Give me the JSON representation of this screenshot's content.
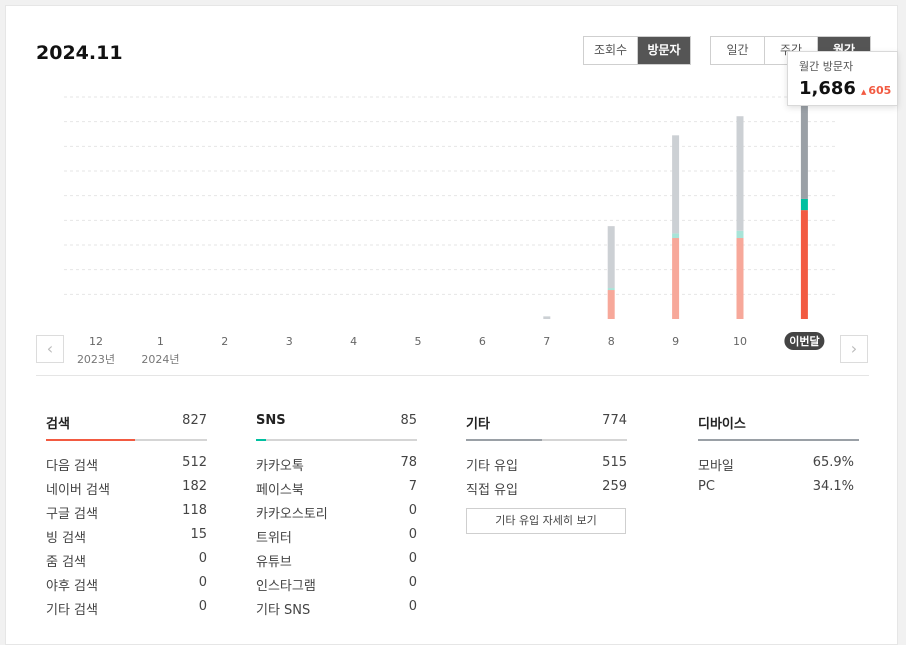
{
  "period_title": "2024.11",
  "metric_toggle": [
    {
      "label": "조회수",
      "active": false
    },
    {
      "label": "방문자",
      "active": true
    }
  ],
  "period_toggle": [
    {
      "label": "일간",
      "active": false
    },
    {
      "label": "주간",
      "active": false
    },
    {
      "label": "월간",
      "active": true
    }
  ],
  "tooltip": {
    "label": "월간 방문자",
    "value": "1,686",
    "delta": "605"
  },
  "colors": {
    "search": "#f25a41",
    "search_light": "#f7a89a",
    "sns": "#00c0a0",
    "sns_light": "#a8e4d8",
    "etc": "#9aa0a6",
    "etc_light": "#ccd0d4",
    "accent_current": "#444444"
  },
  "chart_data": {
    "type": "bar",
    "stacked": true,
    "categories": [
      "12",
      "1",
      "2",
      "3",
      "4",
      "5",
      "6",
      "7",
      "8",
      "9",
      "10",
      "이번달"
    ],
    "year_labels": [
      "2023년",
      "2024년",
      "",
      "",
      "",
      "",
      "",
      "",
      "",
      "",
      "",
      ""
    ],
    "series": [
      {
        "key": "search",
        "values": [
          0,
          0,
          0,
          0,
          0,
          0,
          0,
          0,
          220,
          615,
          615,
          827
        ]
      },
      {
        "key": "sns",
        "values": [
          0,
          0,
          0,
          0,
          0,
          0,
          0,
          0,
          10,
          35,
          55,
          85
        ]
      },
      {
        "key": "etc",
        "values": [
          0,
          0,
          0,
          0,
          0,
          0,
          0,
          20,
          470,
          745,
          870,
          774
        ]
      }
    ],
    "current_index": 11,
    "ylim": [
      0,
      1686
    ],
    "grid": true,
    "grid_lines": 9
  },
  "sections": {
    "search": {
      "title": "검색",
      "total": "827",
      "fill": 0.55,
      "rows": [
        {
          "label": "다음 검색",
          "value": "512"
        },
        {
          "label": "네이버 검색",
          "value": "182"
        },
        {
          "label": "구글 검색",
          "value": "118"
        },
        {
          "label": "빙 검색",
          "value": "15"
        },
        {
          "label": "줌 검색",
          "value": "0"
        },
        {
          "label": "야후 검색",
          "value": "0"
        },
        {
          "label": "기타 검색",
          "value": "0"
        }
      ]
    },
    "sns": {
      "title": "SNS",
      "total": "85",
      "fill": 0.06,
      "rows": [
        {
          "label": "카카오톡",
          "value": "78"
        },
        {
          "label": "페이스북",
          "value": "7"
        },
        {
          "label": "카카오스토리",
          "value": "0"
        },
        {
          "label": "트위터",
          "value": "0"
        },
        {
          "label": "유튜브",
          "value": "0"
        },
        {
          "label": "인스타그램",
          "value": "0"
        },
        {
          "label": "기타 SNS",
          "value": "0"
        }
      ]
    },
    "etc": {
      "title": "기타",
      "total": "774",
      "fill": 0.47,
      "rows": [
        {
          "label": "기타 유입",
          "value": "515"
        },
        {
          "label": "직접 유입",
          "value": "259"
        }
      ],
      "detail_button": "기타 유입 자세히 보기"
    },
    "device": {
      "title": "디바이스",
      "fill": 1.0,
      "rows": [
        {
          "label": "모바일",
          "value": "65.9%"
        },
        {
          "label": "PC",
          "value": "34.1%"
        }
      ]
    }
  }
}
